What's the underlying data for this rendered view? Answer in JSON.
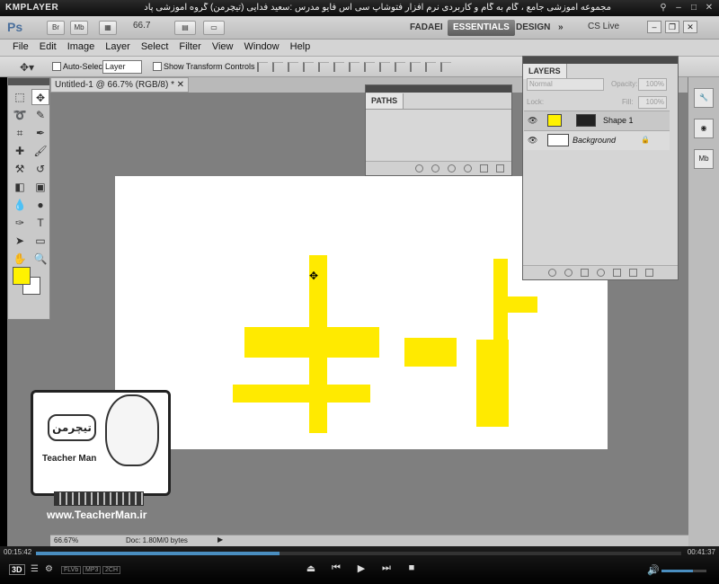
{
  "player": {
    "app_name": "KMPLAYER",
    "caption": "مجموعه آموزشی جامع ، گام به گام و کاربردی نرم افزار فتوشاپ سی اس فایو   مدرس :سعید فدایی (تیچرمن) گروه آموزشی پادشاه گرافیست ها",
    "time_elapsed": "00:15:42",
    "time_total": "00:41:37",
    "progress_fraction": 0.377,
    "volume_fraction": 0.7,
    "badge_3d": "3D",
    "formats": [
      "FLVb",
      "MP3",
      "2CH"
    ]
  },
  "appbar": {
    "logo": "Ps",
    "br_label": "Br",
    "mb_label": "Mb",
    "zoom": "66.7",
    "workspaces": [
      "FADAEI",
      "ESSENTIALS",
      "DESIGN"
    ],
    "active_workspace": "ESSENTIALS",
    "cs_live": "CS Live"
  },
  "menu": [
    "File",
    "Edit",
    "Image",
    "Layer",
    "Select",
    "Filter",
    "View",
    "Window",
    "Help"
  ],
  "options": {
    "auto_select_label": "Auto-Select:",
    "auto_select_value": "Layer",
    "show_transform_label": "Show Transform Controls"
  },
  "document": {
    "tab_title": "Untitled-1 @ 66.7% (RGB/8) *",
    "status_zoom": "66.67%",
    "status_doc": "Doc: 1.80M/0 bytes"
  },
  "panels": {
    "paths_title": "PATHS",
    "layers_title": "LAYERS",
    "blend_mode": "Normal",
    "opacity_label": "Opacity:",
    "opacity_value": "100%",
    "lock_label": "Lock:",
    "fill_label": "Fill:",
    "fill_value": "100%",
    "layers": [
      {
        "name": "Shape 1",
        "color": "#fff200"
      },
      {
        "name": "Background",
        "color": "#ffffff"
      }
    ]
  },
  "colors": {
    "foreground": "#fff200",
    "background": "#ffffff",
    "shape": "#ffea00"
  },
  "watermark": {
    "name": "Teacher Man",
    "url": "www.TeacherMan.ir"
  }
}
